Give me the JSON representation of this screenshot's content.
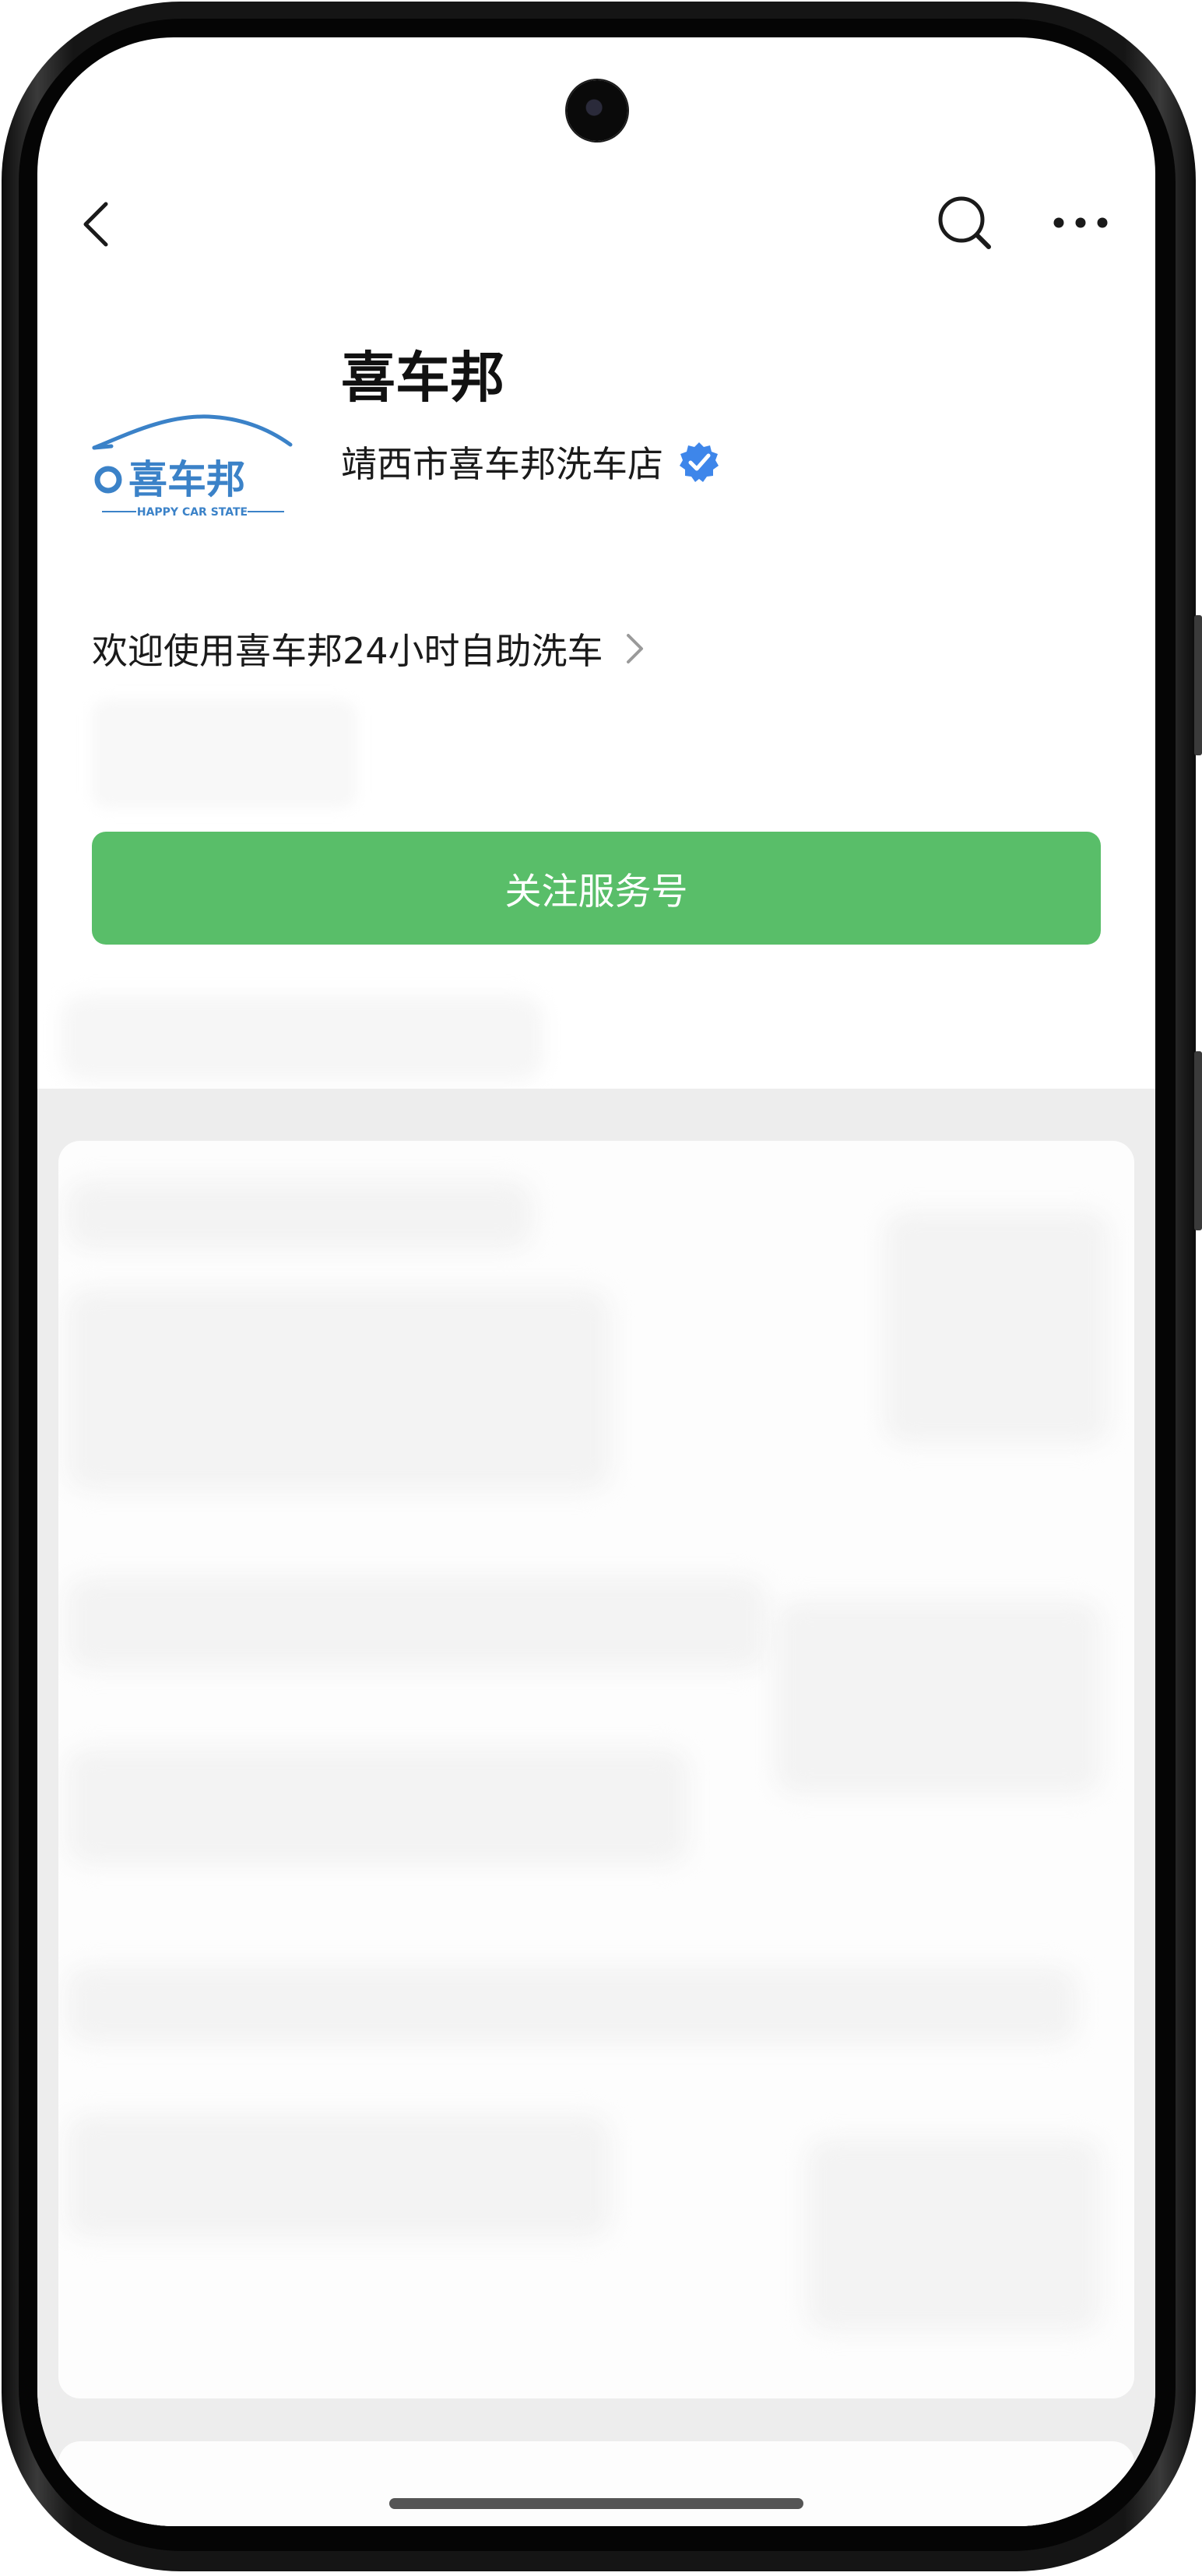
{
  "header": {
    "back_icon": "chevron-left-icon",
    "search_icon": "search-icon",
    "more_icon": "more-dots-icon"
  },
  "profile": {
    "name": "喜车邦",
    "subtitle": "靖西市喜车邦洗车店",
    "verified_icon": "verified-badge-icon",
    "verified_color": "#3e86ea",
    "logo": {
      "text": "喜车邦",
      "tagline": "HAPPY CAR STATE",
      "color": "#3b82c8"
    }
  },
  "intro": {
    "text": "欢迎使用喜车邦24小时自助洗车"
  },
  "follow_button": {
    "label": "关注服务号",
    "color": "#59be69"
  }
}
